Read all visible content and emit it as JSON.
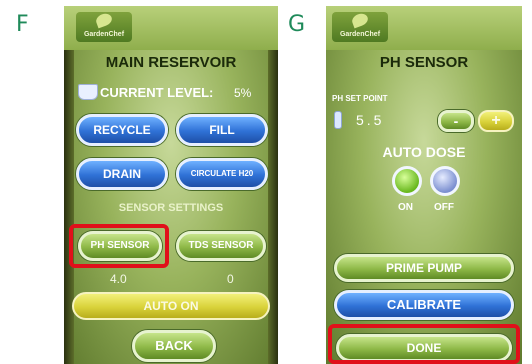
{
  "panels": {
    "f": {
      "letter": "F",
      "logo_text": "GardenChef",
      "title": "MAIN RESERVOIR",
      "current_level_label": "CURRENT LEVEL:",
      "current_level_value": "5%",
      "buttons": {
        "recycle": "RECYCLE",
        "fill": "FILL",
        "drain": "DRAIN",
        "circulate": "CIRCULATE H20"
      },
      "sensor_settings_label": "SENSOR SETTINGS",
      "ph_sensor": "PH SENSOR",
      "tds_sensor": "TDS SENSOR",
      "ph_value": "4.0",
      "tds_value": "0",
      "auto_on": "AUTO ON",
      "back": "BACK"
    },
    "g": {
      "letter": "G",
      "logo_text": "GardenChef",
      "title": "PH SENSOR",
      "set_point_label": "PH SET POINT",
      "set_point_value": "5.5",
      "minus": "-",
      "plus": "+",
      "auto_dose_label": "AUTO DOSE",
      "on_label": "ON",
      "off_label": "OFF",
      "prime_pump": "PRIME PUMP",
      "calibrate": "CALIBRATE",
      "done": "DONE"
    }
  },
  "colors": {
    "highlight_red": "#e0101a",
    "button_blue": "#2f71d6",
    "button_green": "#8eb847",
    "button_yellow": "#d9d23a",
    "panel_letter": "#1f8a5a"
  }
}
